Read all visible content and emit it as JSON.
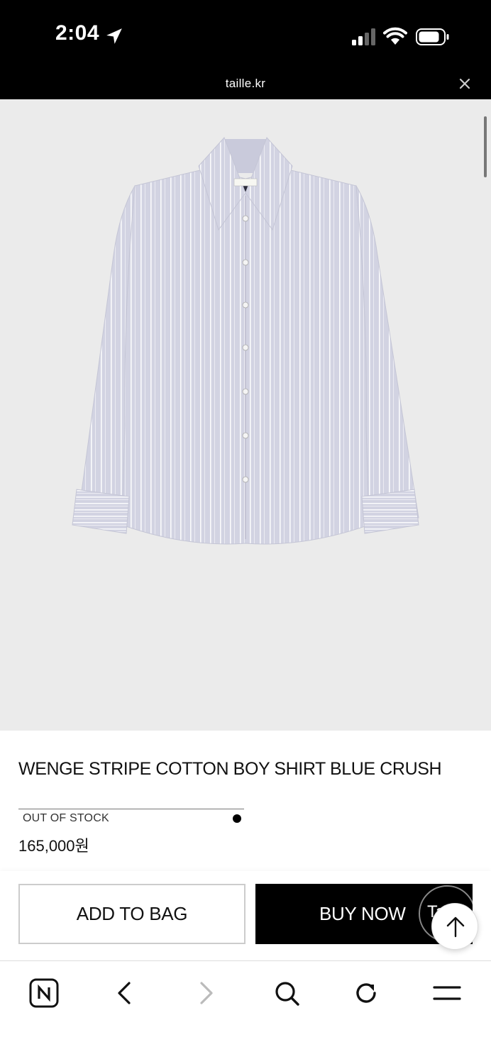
{
  "status_bar": {
    "time": "2:04",
    "icons": [
      "location-arrow-icon",
      "cellular-signal-icon",
      "wifi-icon",
      "battery-icon"
    ]
  },
  "url_bar": {
    "domain": "taille.kr",
    "close_icon": "close-icon"
  },
  "product": {
    "image_description_icon": "shirt-image",
    "collar_label": "Taille",
    "title": "WENGE STRIPE COTTON BOY SHIRT BLUE CRUSH",
    "stock_status": "OUT OF STOCK",
    "price": "165,000원",
    "color_swatch": "#000000"
  },
  "actions": {
    "add_to_bag": "ADD TO BAG",
    "buy_now": "BUY NOW",
    "badge_text": "Ta"
  },
  "toolbar": {
    "items": [
      "naver-home-icon",
      "back-icon",
      "forward-icon",
      "search-icon",
      "refresh-icon",
      "menu-icon"
    ]
  },
  "colors": {
    "status_bg": "#000000",
    "image_bg": "#ebebeb",
    "shirt": "#cfd0e0",
    "buy_bg": "#000000"
  }
}
